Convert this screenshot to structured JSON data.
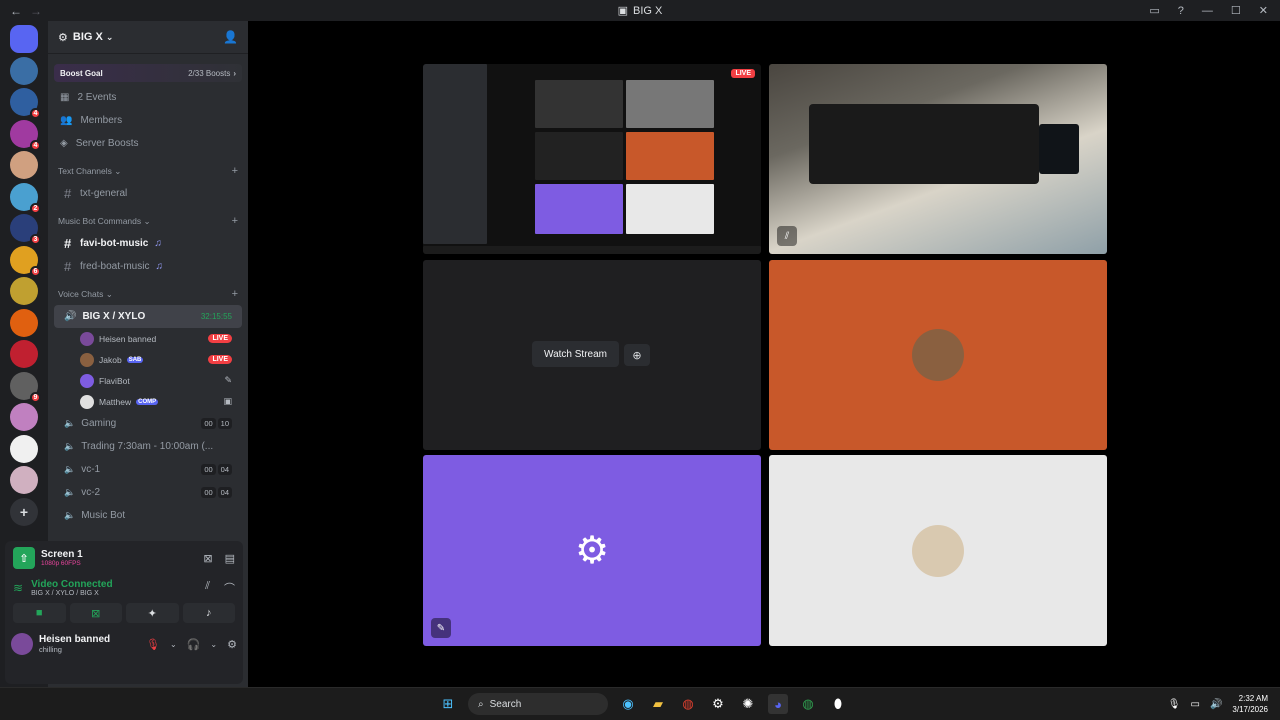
{
  "window": {
    "title": "BIG X"
  },
  "servers": [
    {
      "icon": "discord-home-icon",
      "color": "#5865f2",
      "badge": ""
    },
    {
      "icon": "server-icon",
      "color": "#3a6ea5",
      "badge": ""
    },
    {
      "icon": "server-icon",
      "color": "#2f5fa0",
      "badge": "4"
    },
    {
      "icon": "server-icon",
      "color": "#a03aa0",
      "badge": "4"
    },
    {
      "icon": "server-icon",
      "color": "#d0a080",
      "badge": ""
    },
    {
      "icon": "server-icon",
      "color": "#4aa0d0",
      "badge": "2"
    },
    {
      "icon": "server-icon",
      "color": "#2a3f7a",
      "badge": "3"
    },
    {
      "icon": "server-icon",
      "color": "#e0a020",
      "badge": "6"
    },
    {
      "icon": "server-icon",
      "color": "#c0a030",
      "badge": ""
    },
    {
      "icon": "server-icon",
      "color": "#e06010",
      "badge": ""
    },
    {
      "icon": "server-icon",
      "color": "#c02030",
      "badge": ""
    },
    {
      "icon": "server-icon",
      "color": "#606060",
      "badge": "9"
    },
    {
      "icon": "server-icon",
      "color": "#c080c0",
      "badge": ""
    },
    {
      "icon": "server-icon",
      "color": "#f0f0f0",
      "badge": ""
    },
    {
      "icon": "server-icon",
      "color": "#d0b0c0",
      "badge": ""
    }
  ],
  "guild": {
    "name": "BIG X",
    "boost_label": "Boost Goal",
    "boost_count": "2/33 Boosts",
    "shortcuts": [
      "2 Events",
      "Members",
      "Server Boosts"
    ],
    "categories": {
      "text": "Text Channels",
      "music": "Music Bot Commands",
      "voice": "Voice Chats"
    },
    "text_channels": [
      "txt-general"
    ],
    "music_channels": [
      "favi-bot-music",
      "fred-boat-music"
    ],
    "voice_active": {
      "name": "BIG X / XYLO",
      "timer": "32:15:55"
    },
    "voice_users": [
      {
        "name": "Heisen banned",
        "tag": "",
        "status": "LIVE",
        "color": "#7a4a9a"
      },
      {
        "name": "Jakob",
        "tag": "SAB",
        "status": "LIVE",
        "color": "#8a6040"
      },
      {
        "name": "FlaviBot",
        "tag": "",
        "status": "",
        "color": "#7e5ce2"
      },
      {
        "name": "Matthew",
        "tag": "COMP",
        "status": "",
        "color": "#e0e0e0"
      }
    ],
    "voice_channels": [
      {
        "name": "Gaming",
        "a": "00",
        "b": "10"
      },
      {
        "name": "Trading 7:30am - 10:00am (...",
        "a": "",
        "b": ""
      },
      {
        "name": "vc-1",
        "a": "00",
        "b": "04"
      },
      {
        "name": "vc-2",
        "a": "00",
        "b": "04"
      },
      {
        "name": "Music Bot",
        "a": "",
        "b": ""
      }
    ]
  },
  "panel": {
    "screen_title": "Screen 1",
    "screen_quality": "1080p 60FPS",
    "vc_status": "Video Connected",
    "vc_location": "BIG X / XYLO / BIG X",
    "user_name": "Heisen banned",
    "user_status": "chilling"
  },
  "stage": {
    "live_label": "LIVE",
    "watch_label": "Watch Stream"
  },
  "taskbar": {
    "search": "Search",
    "time": "2:32 AM",
    "date": "3/17/2026"
  }
}
